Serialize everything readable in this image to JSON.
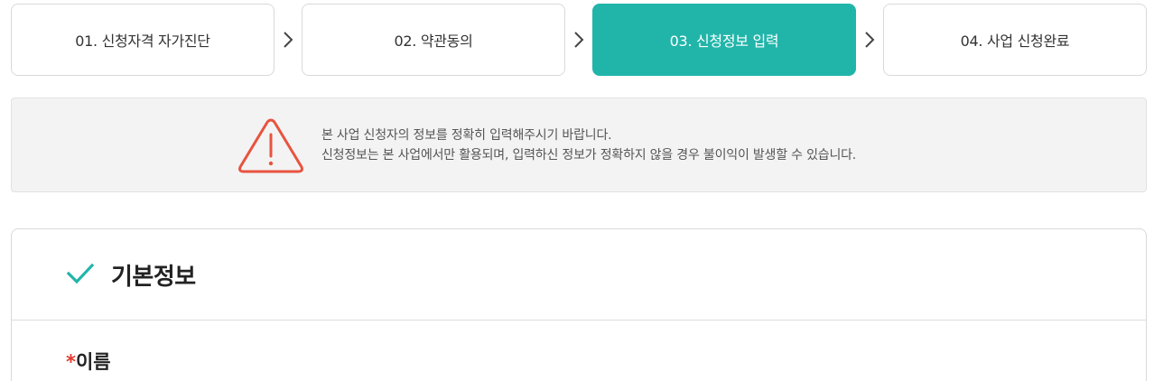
{
  "steps": [
    {
      "label": "01. 신청자격 자가진단",
      "active": false
    },
    {
      "label": "02. 약관동의",
      "active": false
    },
    {
      "label": "03. 신청정보 입력",
      "active": true
    },
    {
      "label": "04. 사업 신청완료",
      "active": false
    }
  ],
  "notice": {
    "icon": "warning-triangle-icon",
    "line1": "본 사업 신청자의 정보를 정확히 입력해주시기 바랍니다.",
    "line2": "신청정보는 본 사업에서만 활용되며, 입력하신 정보가 정확하지 않을 경우 불이익이 발생할 수 있습니다."
  },
  "section": {
    "icon": "check-icon",
    "title": "기본정보"
  },
  "fields": {
    "name": {
      "required_mark": "*",
      "label": "이름"
    }
  },
  "colors": {
    "accent": "#21b5aa",
    "warning": "#e8533f",
    "required": "#e03a2e"
  }
}
